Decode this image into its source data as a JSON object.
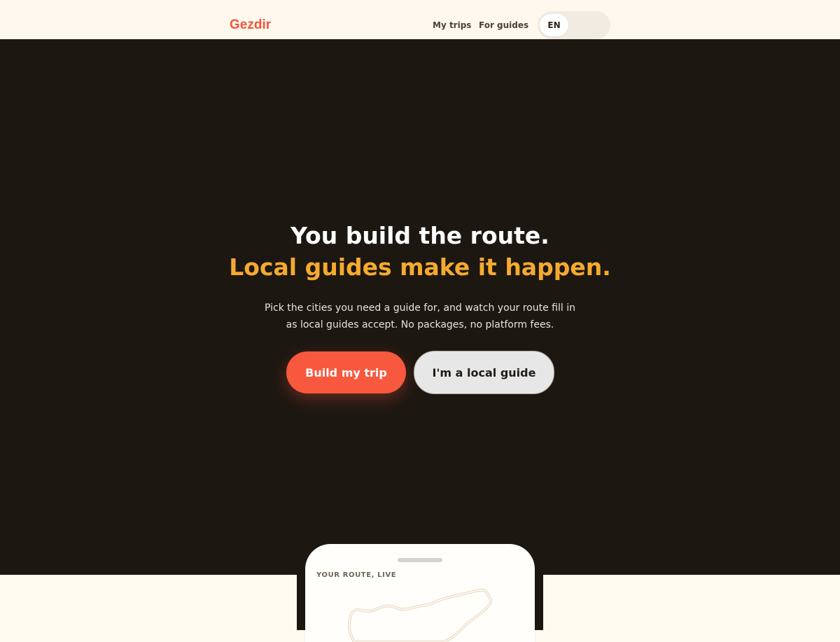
{
  "nav": {
    "brand": "Gezdir",
    "links": [
      "My trips",
      "For guides"
    ],
    "language": "EN"
  },
  "hero": {
    "headline_line1": "You build the route.",
    "headline_line2": "Local guides make it happen.",
    "subtext": "Pick the cities you need a guide for, and watch your route fill in as local guides accept. No packages, no platform fees.",
    "primary_button": "Build my trip",
    "secondary_button": "I'm a local guide"
  },
  "preview": {
    "label": "YOUR ROUTE, LIVE"
  },
  "colors": {
    "brand": "#f1553b",
    "hero_background": "#1d1712",
    "accent_text": "#f5aa2f",
    "primary_button": "#f8583d",
    "secondary_button": "#e7e7e8",
    "page_background": "#fffaf0"
  },
  "icons": {
    "route_map": "turkey-map-outline"
  }
}
